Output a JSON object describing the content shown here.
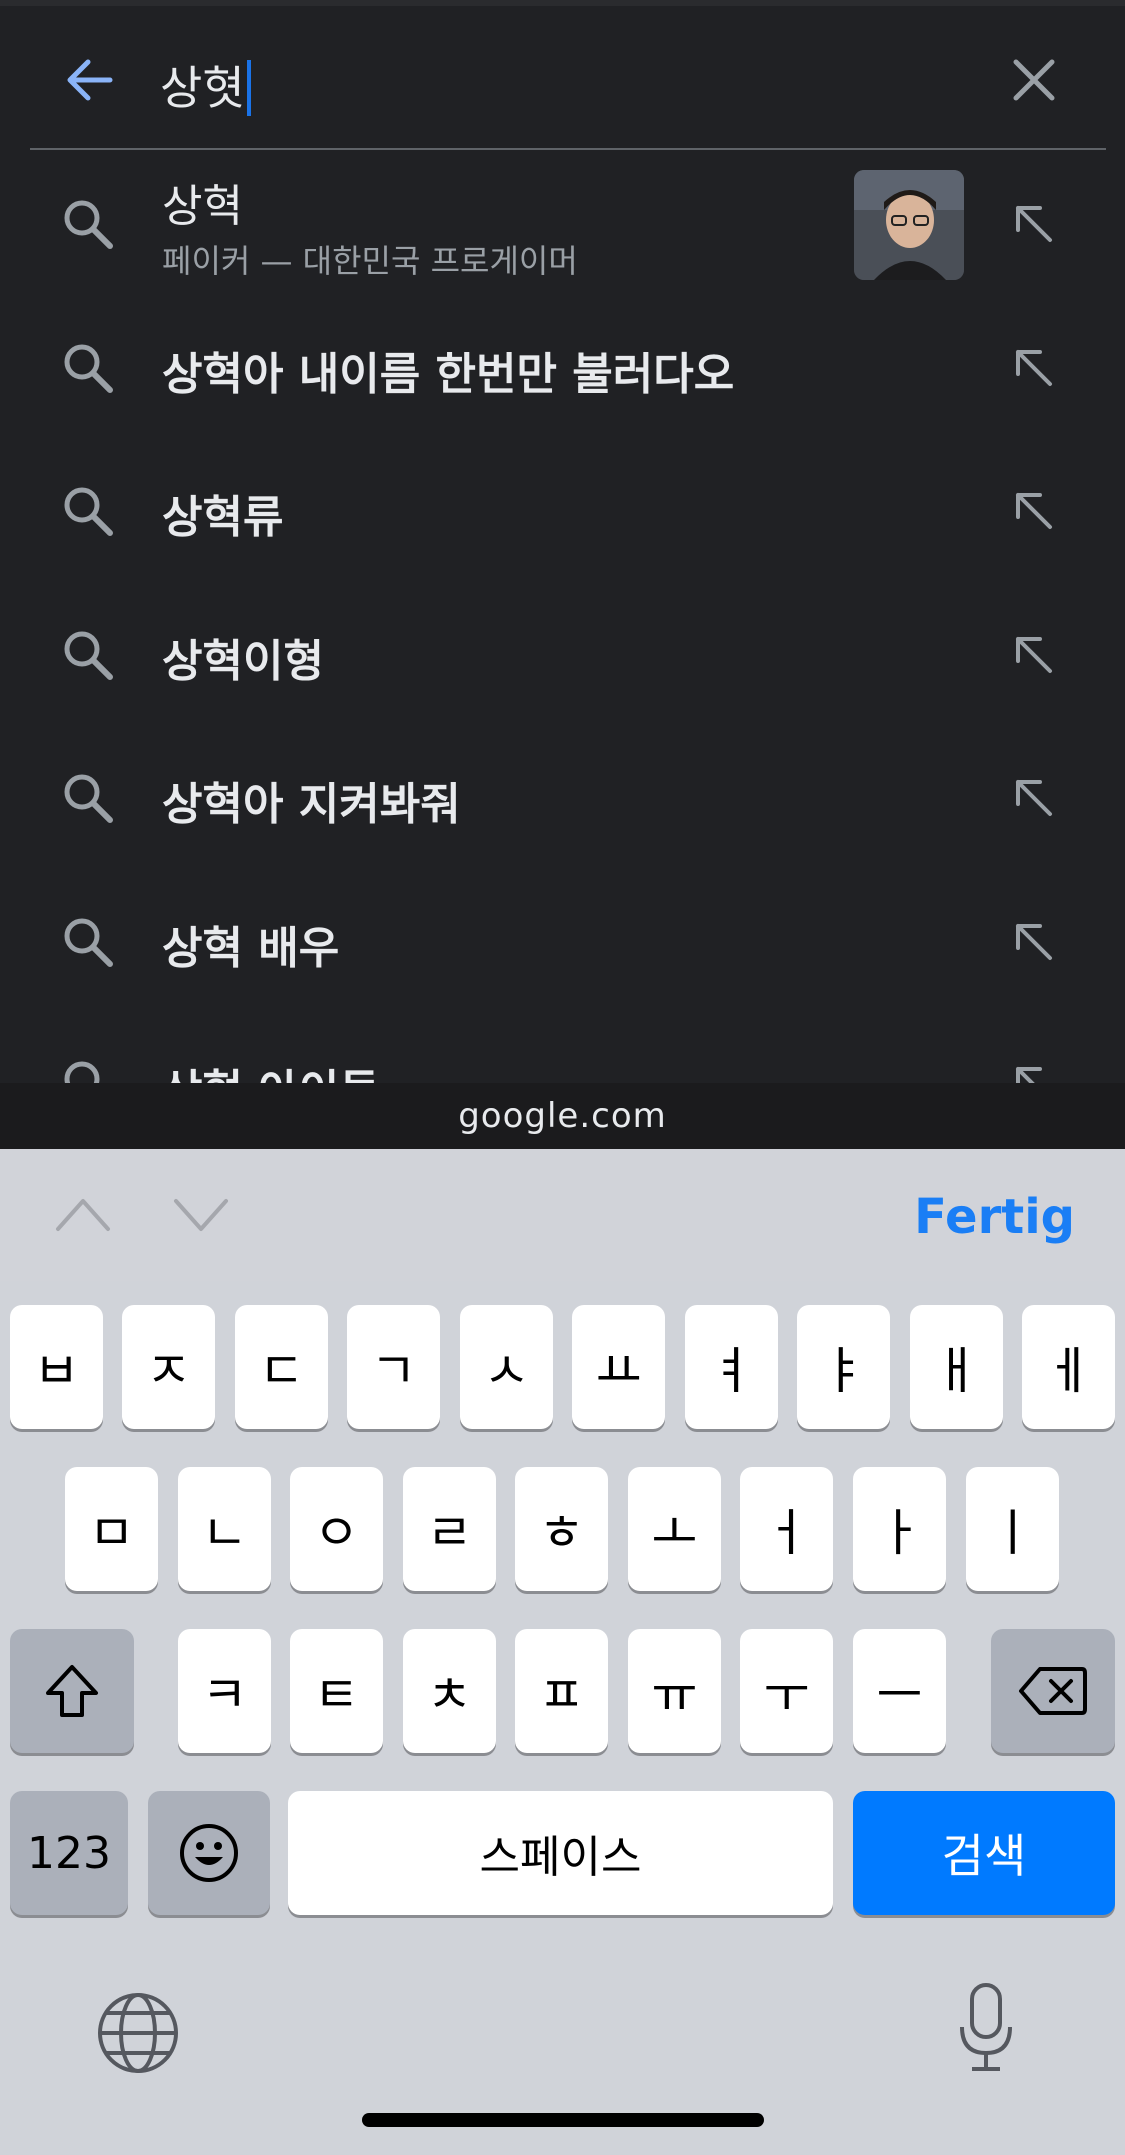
{
  "search": {
    "query": "상혓",
    "suggestions": [
      {
        "title": "상혁",
        "subtitle": "페이커 — 대한민국 프로게이머",
        "has_thumbnail": true
      },
      {
        "title": "상혁아 내이름 한번만 불러다오"
      },
      {
        "title": "상혁류"
      },
      {
        "title": "상혁이형"
      },
      {
        "title": "상혁아 지켜봐줘"
      },
      {
        "title": "상혁 배우"
      },
      {
        "title": "상혁 아이돌"
      }
    ]
  },
  "browser": {
    "url": "google.com"
  },
  "keyboard_toolbar": {
    "done_label": "Fertig"
  },
  "keyboard": {
    "row1": [
      "ㅂ",
      "ㅈ",
      "ㄷ",
      "ㄱ",
      "ㅅ",
      "ㅛ",
      "ㅕ",
      "ㅑ",
      "ㅐ",
      "ㅔ"
    ],
    "row2": [
      "ㅁ",
      "ㄴ",
      "ㅇ",
      "ㄹ",
      "ㅎ",
      "ㅗ",
      "ㅓ",
      "ㅏ",
      "ㅣ"
    ],
    "row3": [
      "ㅋ",
      "ㅌ",
      "ㅊ",
      "ㅍ",
      "ㅠ",
      "ㅜ",
      "ㅡ"
    ],
    "num_label": "123",
    "space_label": "스페이스",
    "search_label": "검색"
  },
  "colors": {
    "accent_blue": "#1a73e8",
    "key_blue": "#007aff",
    "background": "#202124"
  }
}
